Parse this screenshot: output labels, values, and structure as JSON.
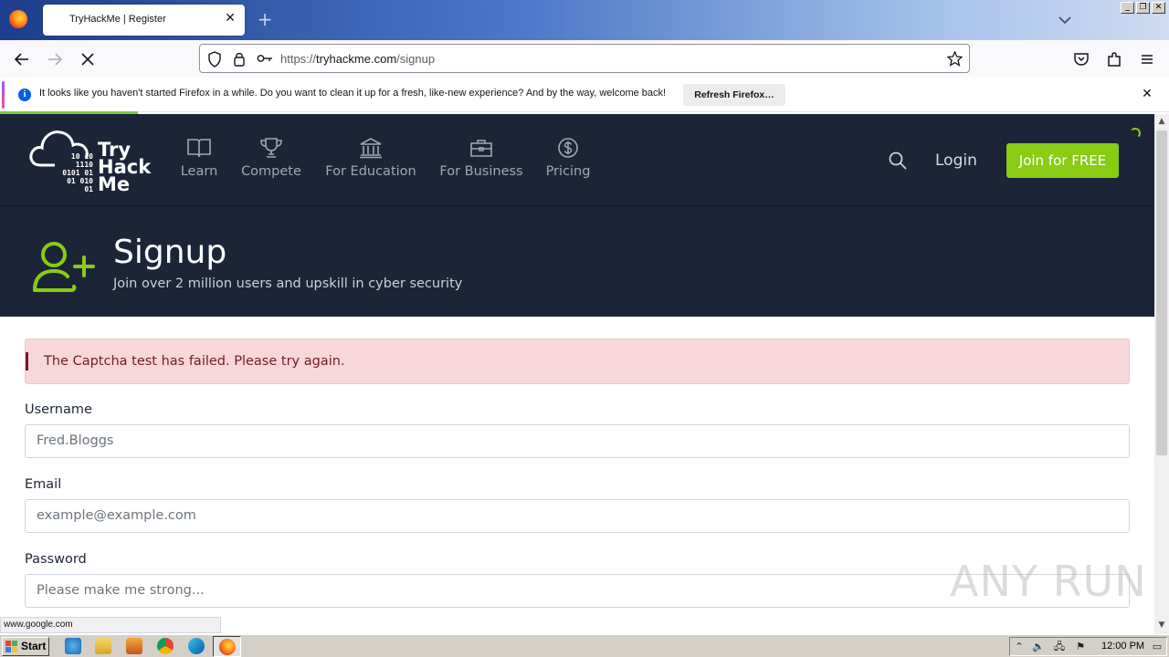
{
  "browser": {
    "tab_title": "TryHackMe | Register",
    "url_prefix": "https://",
    "url_domain": "tryhackme.com",
    "url_path": "/signup",
    "notification_text": "It looks like you haven't started Firefox in a while. Do you want to clean it up for a fresh, like-new experience? And by the way, welcome back!",
    "refresh_button": "Refresh Firefox…",
    "status_url": "www.google.com"
  },
  "site": {
    "logo_word_1": "Try",
    "logo_word_2": "Hack",
    "logo_word_3": "Me",
    "logo_binary": [
      "10 10",
      "1110",
      "0101 01",
      "01 010",
      "01"
    ],
    "nav": [
      {
        "label": "Learn",
        "icon": "book-icon"
      },
      {
        "label": "Compete",
        "icon": "trophy-icon"
      },
      {
        "label": "For Education",
        "icon": "institution-icon"
      },
      {
        "label": "For Business",
        "icon": "briefcase-icon"
      },
      {
        "label": "Pricing",
        "icon": "dollar-icon"
      }
    ],
    "login": "Login",
    "join": "Join for FREE",
    "accent": "#88cc14",
    "header_bg": "#1c2538"
  },
  "hero": {
    "title": "Signup",
    "subtitle": "Join over 2 million users and upskill in cyber security"
  },
  "form": {
    "alert": "The Captcha test has failed. Please try again.",
    "username_label": "Username",
    "username_placeholder": "Fred.Bloggs",
    "email_label": "Email",
    "email_placeholder": "example@example.com",
    "password_label": "Password",
    "password_placeholder": "Please make me strong..."
  },
  "watermark": "ANY RUN",
  "taskbar": {
    "start": "Start",
    "clock": "12:00 PM"
  }
}
